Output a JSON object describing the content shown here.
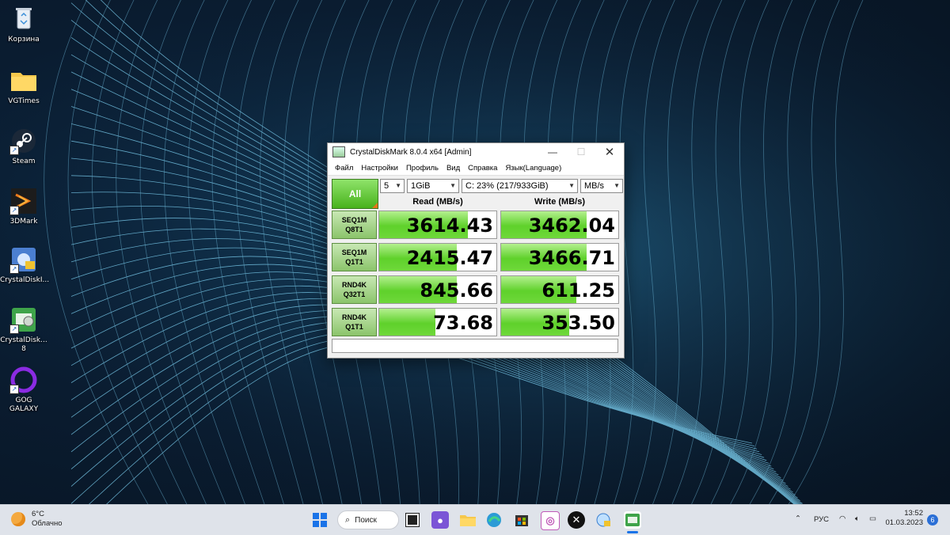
{
  "desktop": {
    "icons": [
      {
        "label": "Корзина",
        "icon": "recycle-bin-icon"
      },
      {
        "label": "VGTimes",
        "icon": "folder-icon"
      },
      {
        "label": "Steam",
        "icon": "steam-icon"
      },
      {
        "label": "3DMark",
        "icon": "3dmark-icon"
      },
      {
        "label": "CrystalDiskI...",
        "icon": "crystaldiskinfo-icon"
      },
      {
        "label": "CrystalDisk...",
        "label2": "8",
        "icon": "crystaldiskmark-icon"
      },
      {
        "label": "GOG GALAXY",
        "icon": "gog-galaxy-icon"
      }
    ]
  },
  "window": {
    "title": "CrystalDiskMark 8.0.4 x64 [Admin]",
    "menu": [
      "Файл",
      "Настройки",
      "Профиль",
      "Вид",
      "Справка",
      "Язык(Language)"
    ],
    "all_button": "All",
    "count": "5",
    "size": "1GiB",
    "drive": "C: 23% (217/933GiB)",
    "unit": "MB/s",
    "read_header": "Read (MB/s)",
    "write_header": "Write (MB/s)",
    "rows": [
      {
        "line1": "SEQ1M",
        "line2": "Q8T1",
        "read": "3614.43",
        "write": "3462.04",
        "read_fill": 0.76,
        "write_fill": 0.73
      },
      {
        "line1": "SEQ1M",
        "line2": "Q1T1",
        "read": "2415.47",
        "write": "3466.71",
        "read_fill": 0.66,
        "write_fill": 0.73
      },
      {
        "line1": "RND4K",
        "line2": "Q32T1",
        "read": "845.66",
        "write": "611.25",
        "read_fill": 0.66,
        "write_fill": 0.64
      },
      {
        "line1": "RND4K",
        "line2": "Q1T1",
        "read": "73.68",
        "write": "353.50",
        "read_fill": 0.48,
        "write_fill": 0.58
      }
    ],
    "comment": ""
  },
  "taskbar": {
    "temperature": "6°C",
    "weather": "Облачно",
    "search_label": "Поиск",
    "language": "РУС",
    "time": "13:52",
    "date": "01.03.2023",
    "notifications": "6"
  },
  "colors": {
    "accent": "#1a73e8",
    "bar_green": "#5fd12b",
    "notif": "#2b6fd6"
  }
}
